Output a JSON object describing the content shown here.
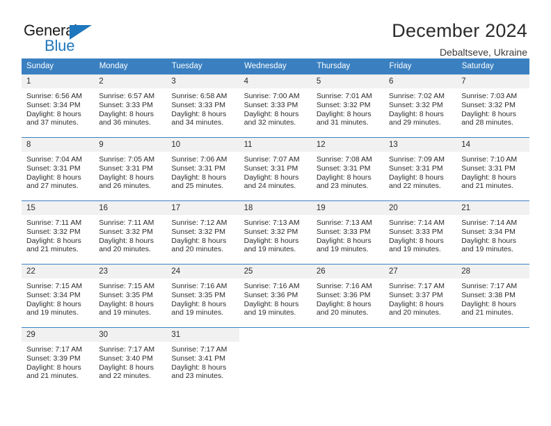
{
  "brand": {
    "name_part1": "General",
    "name_part2": "Blue",
    "accent_color": "#1f77bd",
    "logo_icon": "triangle-flag-icon"
  },
  "header": {
    "title": "December 2024",
    "subtitle": "Debaltseve, Ukraine"
  },
  "calendar": {
    "header_bg": "#3a80c1",
    "daynum_bg": "#f1f1f1",
    "weekday_headers": [
      "Sunday",
      "Monday",
      "Tuesday",
      "Wednesday",
      "Thursday",
      "Friday",
      "Saturday"
    ],
    "weeks": [
      [
        {
          "day": "1",
          "sunrise": "Sunrise: 6:56 AM",
          "sunset": "Sunset: 3:34 PM",
          "daylight_line1": "Daylight: 8 hours",
          "daylight_line2": "and 37 minutes."
        },
        {
          "day": "2",
          "sunrise": "Sunrise: 6:57 AM",
          "sunset": "Sunset: 3:33 PM",
          "daylight_line1": "Daylight: 8 hours",
          "daylight_line2": "and 36 minutes."
        },
        {
          "day": "3",
          "sunrise": "Sunrise: 6:58 AM",
          "sunset": "Sunset: 3:33 PM",
          "daylight_line1": "Daylight: 8 hours",
          "daylight_line2": "and 34 minutes."
        },
        {
          "day": "4",
          "sunrise": "Sunrise: 7:00 AM",
          "sunset": "Sunset: 3:33 PM",
          "daylight_line1": "Daylight: 8 hours",
          "daylight_line2": "and 32 minutes."
        },
        {
          "day": "5",
          "sunrise": "Sunrise: 7:01 AM",
          "sunset": "Sunset: 3:32 PM",
          "daylight_line1": "Daylight: 8 hours",
          "daylight_line2": "and 31 minutes."
        },
        {
          "day": "6",
          "sunrise": "Sunrise: 7:02 AM",
          "sunset": "Sunset: 3:32 PM",
          "daylight_line1": "Daylight: 8 hours",
          "daylight_line2": "and 29 minutes."
        },
        {
          "day": "7",
          "sunrise": "Sunrise: 7:03 AM",
          "sunset": "Sunset: 3:32 PM",
          "daylight_line1": "Daylight: 8 hours",
          "daylight_line2": "and 28 minutes."
        }
      ],
      [
        {
          "day": "8",
          "sunrise": "Sunrise: 7:04 AM",
          "sunset": "Sunset: 3:31 PM",
          "daylight_line1": "Daylight: 8 hours",
          "daylight_line2": "and 27 minutes."
        },
        {
          "day": "9",
          "sunrise": "Sunrise: 7:05 AM",
          "sunset": "Sunset: 3:31 PM",
          "daylight_line1": "Daylight: 8 hours",
          "daylight_line2": "and 26 minutes."
        },
        {
          "day": "10",
          "sunrise": "Sunrise: 7:06 AM",
          "sunset": "Sunset: 3:31 PM",
          "daylight_line1": "Daylight: 8 hours",
          "daylight_line2": "and 25 minutes."
        },
        {
          "day": "11",
          "sunrise": "Sunrise: 7:07 AM",
          "sunset": "Sunset: 3:31 PM",
          "daylight_line1": "Daylight: 8 hours",
          "daylight_line2": "and 24 minutes."
        },
        {
          "day": "12",
          "sunrise": "Sunrise: 7:08 AM",
          "sunset": "Sunset: 3:31 PM",
          "daylight_line1": "Daylight: 8 hours",
          "daylight_line2": "and 23 minutes."
        },
        {
          "day": "13",
          "sunrise": "Sunrise: 7:09 AM",
          "sunset": "Sunset: 3:31 PM",
          "daylight_line1": "Daylight: 8 hours",
          "daylight_line2": "and 22 minutes."
        },
        {
          "day": "14",
          "sunrise": "Sunrise: 7:10 AM",
          "sunset": "Sunset: 3:31 PM",
          "daylight_line1": "Daylight: 8 hours",
          "daylight_line2": "and 21 minutes."
        }
      ],
      [
        {
          "day": "15",
          "sunrise": "Sunrise: 7:11 AM",
          "sunset": "Sunset: 3:32 PM",
          "daylight_line1": "Daylight: 8 hours",
          "daylight_line2": "and 21 minutes."
        },
        {
          "day": "16",
          "sunrise": "Sunrise: 7:11 AM",
          "sunset": "Sunset: 3:32 PM",
          "daylight_line1": "Daylight: 8 hours",
          "daylight_line2": "and 20 minutes."
        },
        {
          "day": "17",
          "sunrise": "Sunrise: 7:12 AM",
          "sunset": "Sunset: 3:32 PM",
          "daylight_line1": "Daylight: 8 hours",
          "daylight_line2": "and 20 minutes."
        },
        {
          "day": "18",
          "sunrise": "Sunrise: 7:13 AM",
          "sunset": "Sunset: 3:32 PM",
          "daylight_line1": "Daylight: 8 hours",
          "daylight_line2": "and 19 minutes."
        },
        {
          "day": "19",
          "sunrise": "Sunrise: 7:13 AM",
          "sunset": "Sunset: 3:33 PM",
          "daylight_line1": "Daylight: 8 hours",
          "daylight_line2": "and 19 minutes."
        },
        {
          "day": "20",
          "sunrise": "Sunrise: 7:14 AM",
          "sunset": "Sunset: 3:33 PM",
          "daylight_line1": "Daylight: 8 hours",
          "daylight_line2": "and 19 minutes."
        },
        {
          "day": "21",
          "sunrise": "Sunrise: 7:14 AM",
          "sunset": "Sunset: 3:34 PM",
          "daylight_line1": "Daylight: 8 hours",
          "daylight_line2": "and 19 minutes."
        }
      ],
      [
        {
          "day": "22",
          "sunrise": "Sunrise: 7:15 AM",
          "sunset": "Sunset: 3:34 PM",
          "daylight_line1": "Daylight: 8 hours",
          "daylight_line2": "and 19 minutes."
        },
        {
          "day": "23",
          "sunrise": "Sunrise: 7:15 AM",
          "sunset": "Sunset: 3:35 PM",
          "daylight_line1": "Daylight: 8 hours",
          "daylight_line2": "and 19 minutes."
        },
        {
          "day": "24",
          "sunrise": "Sunrise: 7:16 AM",
          "sunset": "Sunset: 3:35 PM",
          "daylight_line1": "Daylight: 8 hours",
          "daylight_line2": "and 19 minutes."
        },
        {
          "day": "25",
          "sunrise": "Sunrise: 7:16 AM",
          "sunset": "Sunset: 3:36 PM",
          "daylight_line1": "Daylight: 8 hours",
          "daylight_line2": "and 19 minutes."
        },
        {
          "day": "26",
          "sunrise": "Sunrise: 7:16 AM",
          "sunset": "Sunset: 3:36 PM",
          "daylight_line1": "Daylight: 8 hours",
          "daylight_line2": "and 20 minutes."
        },
        {
          "day": "27",
          "sunrise": "Sunrise: 7:17 AM",
          "sunset": "Sunset: 3:37 PM",
          "daylight_line1": "Daylight: 8 hours",
          "daylight_line2": "and 20 minutes."
        },
        {
          "day": "28",
          "sunrise": "Sunrise: 7:17 AM",
          "sunset": "Sunset: 3:38 PM",
          "daylight_line1": "Daylight: 8 hours",
          "daylight_line2": "and 21 minutes."
        }
      ],
      [
        {
          "day": "29",
          "sunrise": "Sunrise: 7:17 AM",
          "sunset": "Sunset: 3:39 PM",
          "daylight_line1": "Daylight: 8 hours",
          "daylight_line2": "and 21 minutes."
        },
        {
          "day": "30",
          "sunrise": "Sunrise: 7:17 AM",
          "sunset": "Sunset: 3:40 PM",
          "daylight_line1": "Daylight: 8 hours",
          "daylight_line2": "and 22 minutes."
        },
        {
          "day": "31",
          "sunrise": "Sunrise: 7:17 AM",
          "sunset": "Sunset: 3:41 PM",
          "daylight_line1": "Daylight: 8 hours",
          "daylight_line2": "and 23 minutes."
        },
        {
          "day": "",
          "sunrise": "",
          "sunset": "",
          "daylight_line1": "",
          "daylight_line2": ""
        },
        {
          "day": "",
          "sunrise": "",
          "sunset": "",
          "daylight_line1": "",
          "daylight_line2": ""
        },
        {
          "day": "",
          "sunrise": "",
          "sunset": "",
          "daylight_line1": "",
          "daylight_line2": ""
        },
        {
          "day": "",
          "sunrise": "",
          "sunset": "",
          "daylight_line1": "",
          "daylight_line2": ""
        }
      ]
    ]
  }
}
